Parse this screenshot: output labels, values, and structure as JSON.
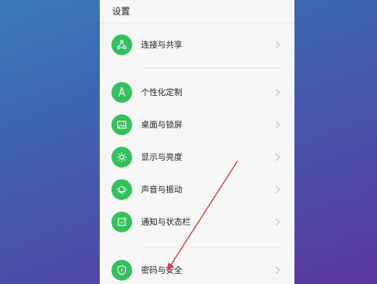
{
  "header": {
    "title": "设置"
  },
  "items": [
    {
      "label": "连接与共享",
      "icon": "share-icon"
    },
    {
      "label": "个性化定制",
      "icon": "compass-icon"
    },
    {
      "label": "桌面与锁屏",
      "icon": "image-icon"
    },
    {
      "label": "显示与亮度",
      "icon": "sun-icon"
    },
    {
      "label": "声音与振动",
      "icon": "bell-icon"
    },
    {
      "label": "通知与状态栏",
      "icon": "notification-icon"
    },
    {
      "label": "密码与安全",
      "icon": "shield-icon"
    }
  ],
  "colors": {
    "icon_bg": "#31c25b",
    "accent_arrow": "#e03a3a"
  }
}
